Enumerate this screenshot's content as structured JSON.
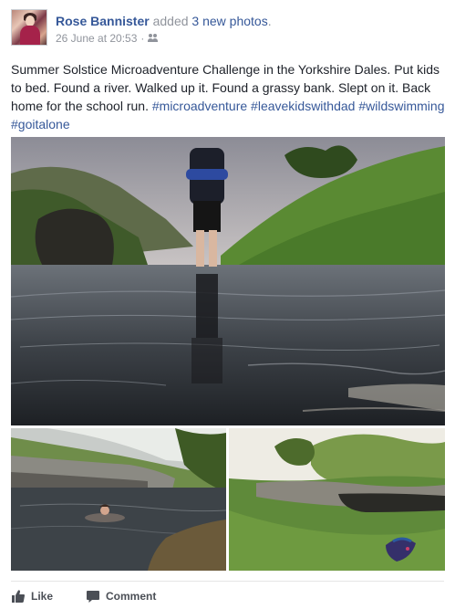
{
  "post": {
    "author": "Rose Bannister",
    "action_prefix": "added",
    "action_link": "3 new photos",
    "action_suffix": ".",
    "timestamp": "26 June at 20:53",
    "separator": "·",
    "audience_icon": "friends-icon",
    "text": "Summer Solstice Microadventure Challenge in the Yorkshire Dales. Put kids to bed. Found a river. Walked up it. Found a grassy bank. Slept on it. Back home for the school run.",
    "hashtags": [
      "#microadventure",
      "#leavekidswithdad",
      "#wildswimming",
      "#goitalone"
    ]
  },
  "photos": [
    {
      "icon": "photo-hiker-in-river"
    },
    {
      "icon": "photo-wild-swimmer"
    },
    {
      "icon": "photo-bivvy-on-grassy-bank"
    }
  ],
  "actions": {
    "like_label": "Like",
    "comment_label": "Comment",
    "like_icon": "thumbs-up-icon",
    "comment_icon": "comment-icon"
  },
  "colors": {
    "link": "#365899",
    "meta": "#90949c",
    "text": "#1d2129"
  }
}
